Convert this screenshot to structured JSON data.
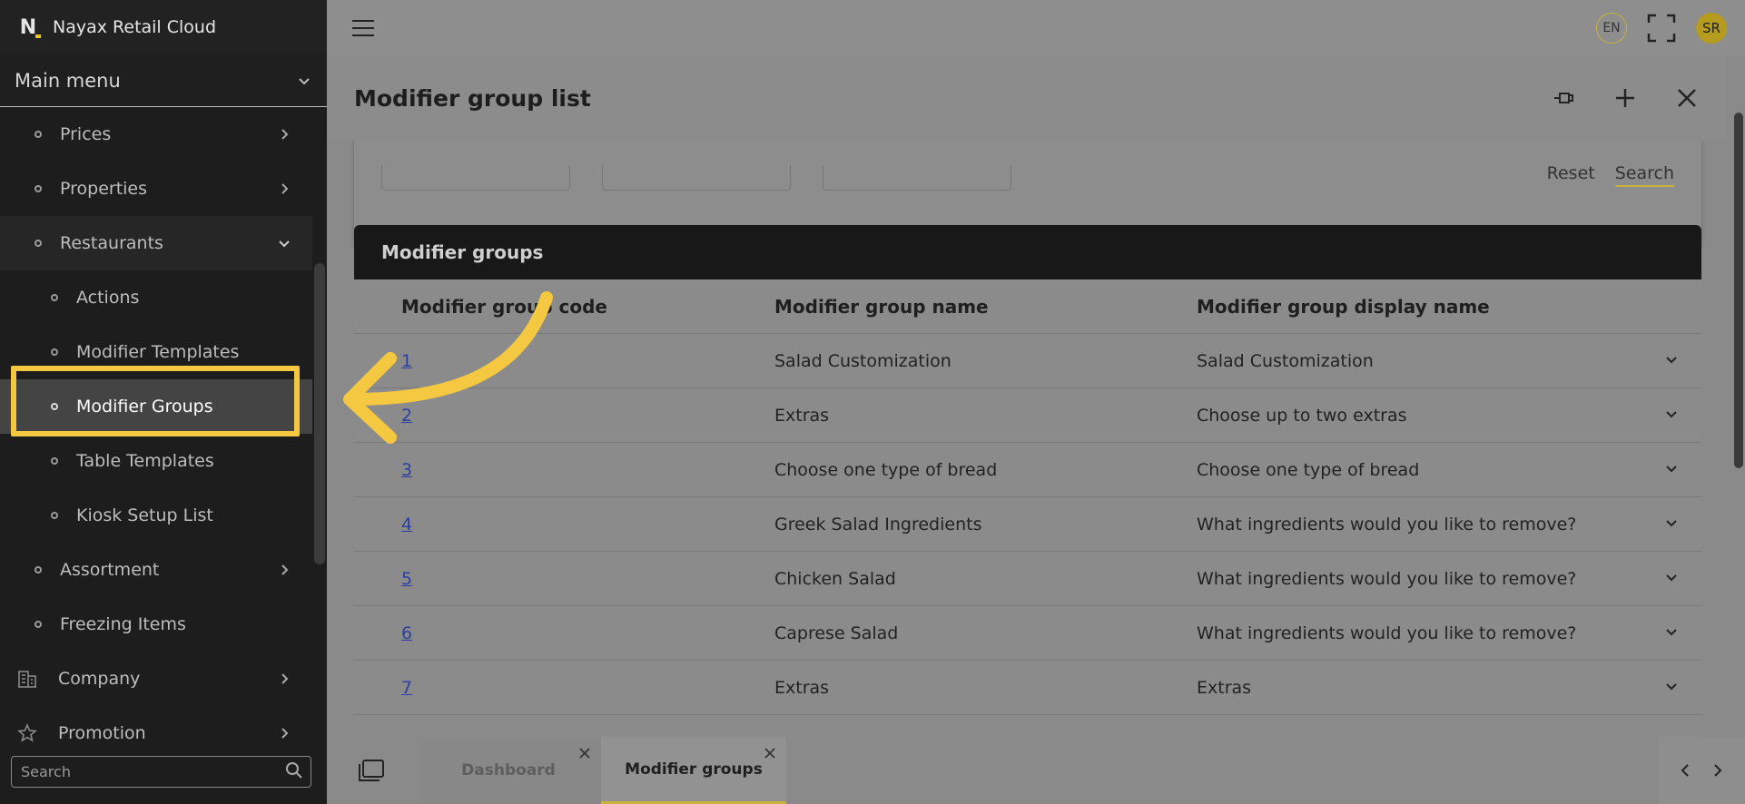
{
  "brand": {
    "name": "Nayax Retail Cloud",
    "logo_letter": "N"
  },
  "sidebar": {
    "main_menu_label": "Main menu",
    "items": [
      {
        "label": "Prices",
        "level": 1,
        "chevron": "right"
      },
      {
        "label": "Properties",
        "level": 1,
        "chevron": "right"
      },
      {
        "label": "Restaurants",
        "level": 1,
        "chevron": "down"
      },
      {
        "label": "Actions",
        "level": 2
      },
      {
        "label": "Modifier Templates",
        "level": 2
      },
      {
        "label": "Modifier Groups",
        "level": 2,
        "active": true
      },
      {
        "label": "Table Templates",
        "level": 2
      },
      {
        "label": "Kiosk Setup List",
        "level": 2
      },
      {
        "label": "Assortment",
        "level": 1,
        "chevron": "right"
      },
      {
        "label": "Freezing Items",
        "level": 1
      },
      {
        "label": "Company",
        "level": 0,
        "icon": "building-icon",
        "chevron": "right"
      },
      {
        "label": "Promotion",
        "level": 0,
        "icon": "star-icon",
        "chevron": "right"
      }
    ],
    "search_placeholder": "Search"
  },
  "topbar": {
    "language": "EN",
    "avatar_initials": "SR"
  },
  "page": {
    "title": "Modifier group list",
    "filter_reset": "Reset",
    "filter_search": "Search"
  },
  "table": {
    "title": "Modifier groups",
    "columns": [
      "Modifier group code",
      "Modifier group name",
      "Modifier group display name"
    ],
    "rows": [
      {
        "code": "1",
        "name": "Salad Customization",
        "display_name": "Salad Customization"
      },
      {
        "code": "2",
        "name": "Extras",
        "display_name": "Choose up to two extras"
      },
      {
        "code": "3",
        "name": "Choose one type of bread",
        "display_name": "Choose one type of bread"
      },
      {
        "code": "4",
        "name": "Greek Salad Ingredients",
        "display_name": "What ingredients would you like to remove?"
      },
      {
        "code": "5",
        "name": "Chicken Salad",
        "display_name": "What ingredients would you like to remove?"
      },
      {
        "code": "6",
        "name": "Caprese Salad",
        "display_name": "What ingredients would you like to remove?"
      },
      {
        "code": "7",
        "name": "Extras",
        "display_name": "Extras"
      }
    ]
  },
  "tabs": [
    {
      "label": "Dashboard",
      "active": false
    },
    {
      "label": "Modifier groups",
      "active": true
    }
  ],
  "colors": {
    "accent": "#f5c842",
    "sidebar_bg": "#1d1d1d",
    "link": "#2d3fa0"
  }
}
